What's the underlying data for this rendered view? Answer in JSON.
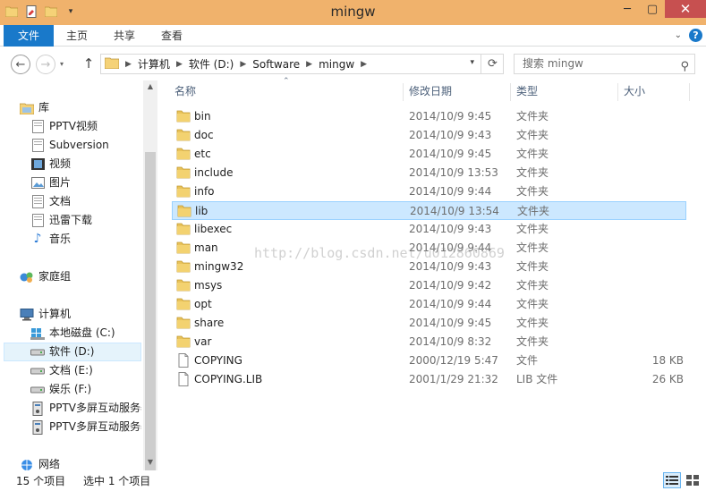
{
  "window": {
    "title": "mingw"
  },
  "ribbon": {
    "tabs": [
      "文件",
      "主页",
      "共享",
      "查看"
    ]
  },
  "address": {
    "crumbs": [
      "计算机",
      "软件 (D:)",
      "Software",
      "mingw"
    ],
    "search_placeholder": "搜索 mingw"
  },
  "sidebar": {
    "library": "库",
    "library_items": [
      "PPTV视频",
      "Subversion",
      "视频",
      "图片",
      "文档",
      "迅雷下载",
      "音乐"
    ],
    "homegroup": "家庭组",
    "computer": "计算机",
    "computer_items": [
      "本地磁盘 (C:)",
      "软件 (D:)",
      "文档 (E:)",
      "娱乐 (F:)",
      "PPTV多屏互动服务器",
      "PPTV多屏互动服务器"
    ],
    "network": "网络"
  },
  "columns": {
    "name": "名称",
    "date": "修改日期",
    "type": "类型",
    "size": "大小"
  },
  "files": [
    {
      "name": "bin",
      "date": "2014/10/9 9:45",
      "type": "文件夹",
      "size": "",
      "icon": "folder-icon"
    },
    {
      "name": "doc",
      "date": "2014/10/9 9:43",
      "type": "文件夹",
      "size": "",
      "icon": "folder-icon"
    },
    {
      "name": "etc",
      "date": "2014/10/9 9:45",
      "type": "文件夹",
      "size": "",
      "icon": "folder-icon"
    },
    {
      "name": "include",
      "date": "2014/10/9 13:53",
      "type": "文件夹",
      "size": "",
      "icon": "folder-icon"
    },
    {
      "name": "info",
      "date": "2014/10/9 9:44",
      "type": "文件夹",
      "size": "",
      "icon": "folder-icon"
    },
    {
      "name": "lib",
      "date": "2014/10/9 13:54",
      "type": "文件夹",
      "size": "",
      "icon": "folder-icon"
    },
    {
      "name": "libexec",
      "date": "2014/10/9 9:43",
      "type": "文件夹",
      "size": "",
      "icon": "folder-icon"
    },
    {
      "name": "man",
      "date": "2014/10/9 9:44",
      "type": "文件夹",
      "size": "",
      "icon": "folder-icon"
    },
    {
      "name": "mingw32",
      "date": "2014/10/9 9:43",
      "type": "文件夹",
      "size": "",
      "icon": "folder-icon"
    },
    {
      "name": "msys",
      "date": "2014/10/9 9:42",
      "type": "文件夹",
      "size": "",
      "icon": "folder-icon"
    },
    {
      "name": "opt",
      "date": "2014/10/9 9:44",
      "type": "文件夹",
      "size": "",
      "icon": "folder-icon"
    },
    {
      "name": "share",
      "date": "2014/10/9 9:45",
      "type": "文件夹",
      "size": "",
      "icon": "folder-icon"
    },
    {
      "name": "var",
      "date": "2014/10/9 8:32",
      "type": "文件夹",
      "size": "",
      "icon": "folder-icon"
    },
    {
      "name": "COPYING",
      "date": "2000/12/19 5:47",
      "type": "文件",
      "size": "18 KB",
      "icon": "file-icon"
    },
    {
      "name": "COPYING.LIB",
      "date": "2001/1/29 21:32",
      "type": "LIB 文件",
      "size": "26 KB",
      "icon": "file-icon"
    }
  ],
  "selected_index": 5,
  "watermark": "http://blog.csdn.net/u012860869",
  "status": {
    "count": "15 个项目",
    "selection": "选中 1 个项目"
  },
  "colors": {
    "titlebar": "#f0b26c",
    "file_tab": "#1979ca",
    "close": "#c75050",
    "selection": "#cce8ff",
    "folder": "#e8c25a"
  }
}
